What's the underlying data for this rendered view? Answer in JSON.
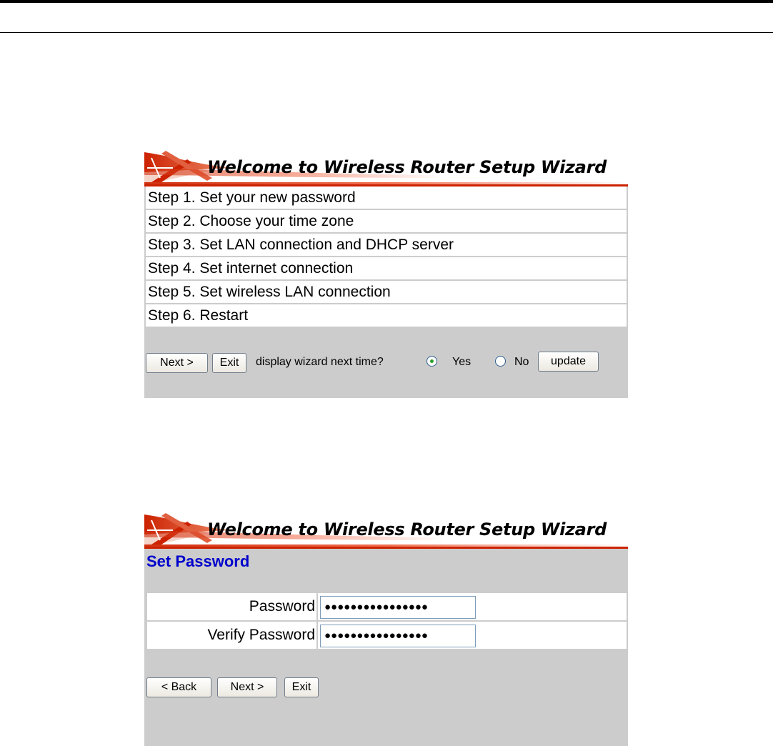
{
  "banner_title": "Welcome to Wireless Router Setup Wizard",
  "wizard_steps": [
    "Step 1. Set your new password",
    "Step 2. Choose your time zone",
    "Step 3. Set LAN connection and DHCP server",
    "Step 4. Set internet connection",
    "Step 5. Set wireless LAN connection",
    "Step 6. Restart"
  ],
  "welcome_controls": {
    "next_label": "Next >",
    "exit_label": "Exit",
    "question": "display wizard next time?",
    "yes_label": "Yes",
    "no_label": "No",
    "selected": "Yes",
    "update_label": "update"
  },
  "password_form": {
    "section_title": "Set Password",
    "password_label": "Password",
    "password_value": "●●●●●●●●●●●●●●●●",
    "verify_label": "Verify Password",
    "verify_value": "●●●●●●●●●●●●●●●●",
    "back_label": "< Back",
    "next_label": "Next >",
    "exit_label": "Exit"
  },
  "colors": {
    "panel_bg": "#cccccc",
    "section_title": "#0000cc",
    "banner_accent": "#cc2200"
  }
}
